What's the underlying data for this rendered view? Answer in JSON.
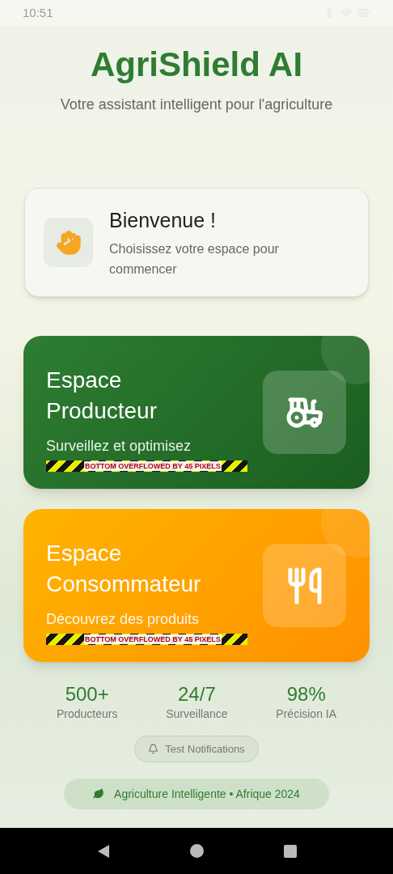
{
  "status_bar": {
    "time": "10:51"
  },
  "header": {
    "title": "AgriShield AI",
    "subtitle": "Votre assistant intelligent pour l'agriculture"
  },
  "welcome": {
    "title": "Bienvenue !",
    "subtitle": "Choisissez votre espace pour commencer"
  },
  "spaces": [
    {
      "kind": "producer",
      "title": "Espace Producteur",
      "subtitle": "Surveillez et optimisez",
      "overflow_label": "BOTTOM OVERFLOWED BY 45 PIXELS"
    },
    {
      "kind": "consumer",
      "title": "Espace Consommateur",
      "subtitle": "Découvrez des produits",
      "overflow_label": "BOTTOM OVERFLOWED BY 45 PIXELS"
    }
  ],
  "stats": [
    {
      "value": "500+",
      "label": "Producteurs"
    },
    {
      "value": "24/7",
      "label": "Surveillance"
    },
    {
      "value": "98%",
      "label": "Précision IA"
    }
  ],
  "test_button": {
    "label": "Test Notifications"
  },
  "footer": {
    "label": "Agriculture Intelligente • Afrique 2024"
  }
}
